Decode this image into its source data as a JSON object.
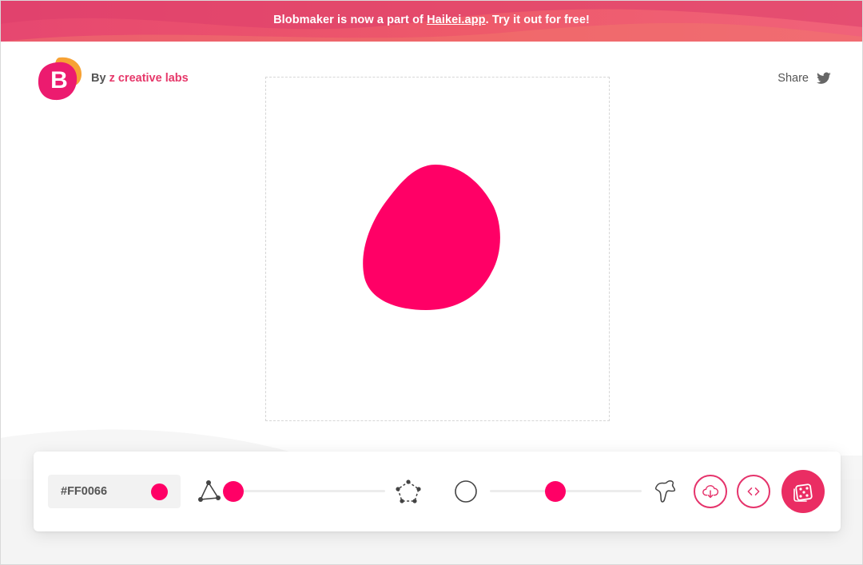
{
  "colors": {
    "accent": "#FF0066",
    "brand_pink": "#e5336b",
    "brand_orange": "#f7a234",
    "button_primary": "#ea2d63"
  },
  "banner": {
    "text_before": "Blobmaker is now a part of ",
    "link": "Haikei.app",
    "text_after": ". Try it out for free!"
  },
  "header": {
    "logo_letter": "B",
    "by_label": "By",
    "author": "z creative labs",
    "share_label": "Share",
    "share_icon": "twitter-icon"
  },
  "toolbar": {
    "color_value": "#FF0066",
    "complexity": {
      "min_icon": "triangle-nodes-icon",
      "max_icon": "pentagon-nodes-icon",
      "value_fraction": 0.0
    },
    "contrast": {
      "min_icon": "circle-icon",
      "max_icon": "spiky-shape-icon",
      "value_fraction": 0.43
    },
    "buttons": {
      "download_icon": "cloud-download-icon",
      "code_icon": "code-icon",
      "random_icon": "dice-icon"
    }
  }
}
